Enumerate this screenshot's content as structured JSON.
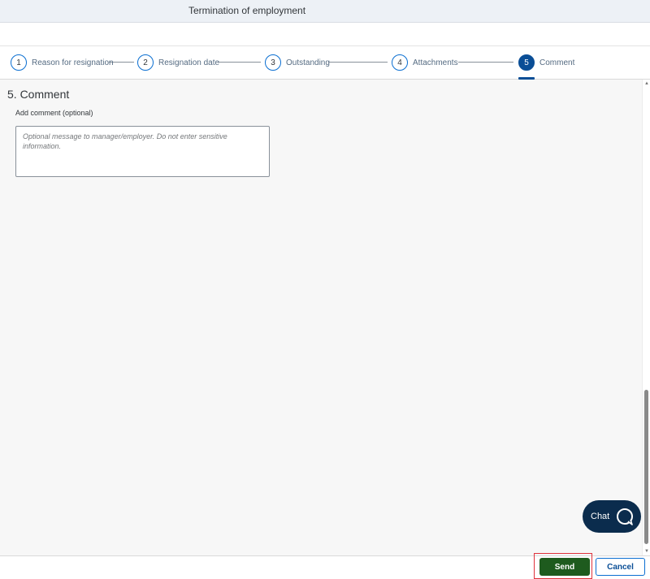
{
  "window": {
    "title": "Termination of employment"
  },
  "stepper": {
    "steps": [
      {
        "number": "1",
        "label": "Reason for resignation"
      },
      {
        "number": "2",
        "label": "Resignation date"
      },
      {
        "number": "3",
        "label": "Outstanding"
      },
      {
        "number": "4",
        "label": "Attachments"
      },
      {
        "number": "5",
        "label": "Comment"
      }
    ],
    "active_step": "5"
  },
  "section": {
    "title": "5. Comment",
    "field_label": "Add comment (optional)",
    "comment_placeholder": "Optional message to manager/employer. Do not enter sensitive information.",
    "comment_value": ""
  },
  "chat": {
    "label": "Chat",
    "icon": "chat-bubble-icon"
  },
  "footer": {
    "send_label": "Send",
    "cancel_label": "Cancel"
  },
  "colors": {
    "accent": "#0a4e96",
    "send": "#1e5b1e",
    "highlight": "#e0323c",
    "chat": "#0b2c4d"
  }
}
